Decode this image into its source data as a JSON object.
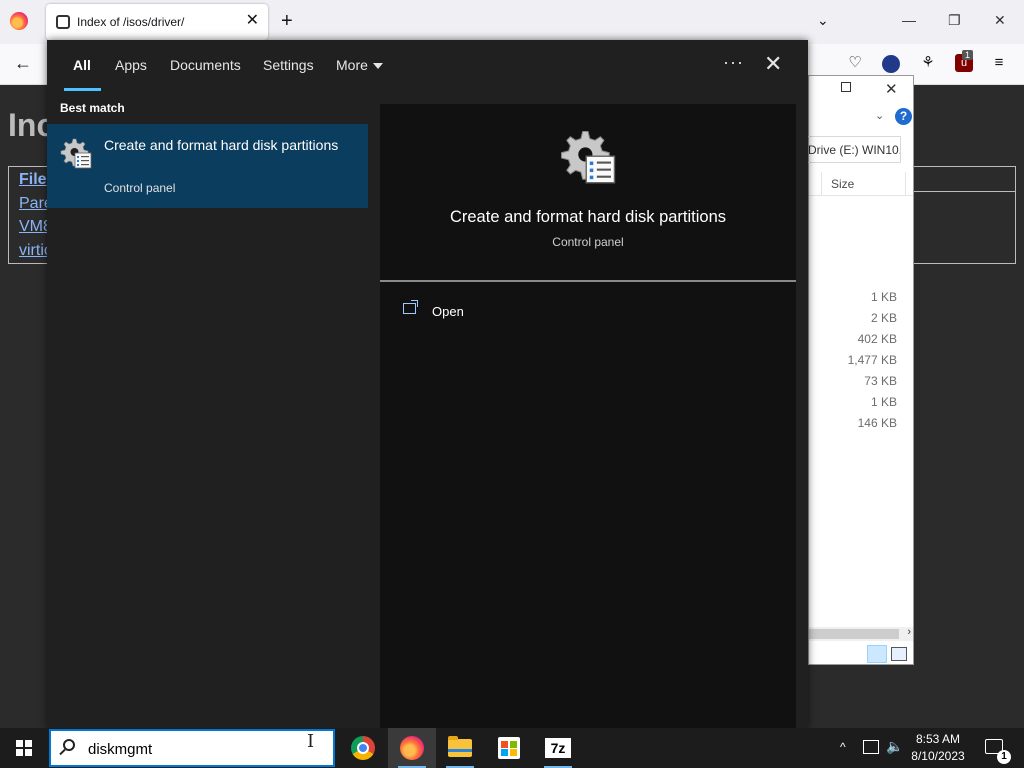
{
  "browser": {
    "tab_title": "Index of /isos/driver/",
    "tab_close": "✕",
    "new_tab": "+",
    "tablist": "⌄",
    "window_minimize": "—",
    "window_restore": "❐",
    "window_close": "✕",
    "back": "←",
    "toolbar": {
      "pocket": "♡",
      "extensions": "⚘",
      "ublock": "u",
      "ublock_badge": "1",
      "menu": "≡"
    },
    "page": {
      "heading": "Inc",
      "links": [
        "File",
        "Pare",
        "VM8",
        "virtic"
      ]
    }
  },
  "explorer": {
    "close": "✕",
    "chevron": "⌄",
    "help": "?",
    "address": "Drive (E:) WIN10...",
    "size_header": "Size",
    "sizes": [
      "1 KB",
      "2 KB",
      "402 KB",
      "1,477 KB",
      "73 KB",
      "1 KB",
      "146 KB"
    ],
    "scroll_arrow": "›"
  },
  "search_panel": {
    "tabs": [
      "All",
      "Apps",
      "Documents",
      "Settings",
      "More"
    ],
    "more_options": "···",
    "close": "✕",
    "best_match_label": "Best match",
    "best_match": {
      "title": "Create and format hard disk partitions",
      "subtitle": "Control panel"
    },
    "detail": {
      "title": "Create and format hard disk partitions",
      "subtitle": "Control panel",
      "actions": [
        "Open"
      ]
    }
  },
  "taskbar": {
    "search_value": "diskmgmt",
    "text_cursor": "I",
    "sevenzip_label": "7z",
    "tray_chevron": "^",
    "volume": "🔈",
    "time": "8:53 AM",
    "date": "8/10/2023",
    "notification_count": "1"
  },
  "colors": {
    "accent": "#4cc2ff",
    "selection": "#0b3d5e",
    "panel_bg": "#202020",
    "detail_bg": "#111111",
    "taskbar_bg": "#1c1c1c"
  }
}
